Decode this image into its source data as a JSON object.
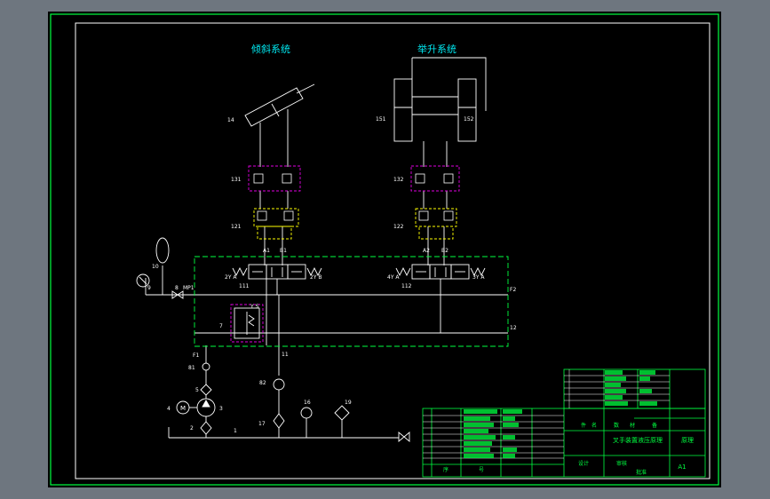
{
  "titles": {
    "tilt": "倾斜系统",
    "lift": "举升系统"
  },
  "labels": {
    "c14": "14",
    "c151": "151",
    "c152": "152",
    "v131": "131",
    "v132": "132",
    "v121": "121",
    "v122": "122",
    "a1": "A1",
    "b1": "B1",
    "a2": "A2",
    "b2": "B2",
    "v111": "111",
    "v112": "112",
    "p2a": "2Y A",
    "p2b": "2Y B",
    "p4a": "4Y A",
    "p4b": "3Y A",
    "f1": "F1",
    "f2": "F2",
    "t11": "11",
    "t12": "12",
    "n10": "10",
    "n9": "9",
    "n8": "8",
    "mp1": "MP1",
    "n7": "7",
    "rv": "Y S",
    "n81": "81",
    "n82": "82",
    "n4": "4",
    "n5": "5",
    "n3": "3",
    "n2": "2",
    "n1": "1",
    "n16": "16",
    "n17": "17",
    "n19": "19",
    "m": "M"
  },
  "titleblock": {
    "drawing_name": "叉手装置液压原理",
    "drawing_name2": "原理",
    "scale": "A1",
    "col_a": "序",
    "col_b": "号",
    "row_labels": [
      "件",
      "名",
      "数",
      "材",
      "备"
    ],
    "signs": [
      "设计",
      "审核",
      "批准"
    ]
  },
  "colors": {
    "frame": "#00ff40",
    "sheet": "#000000",
    "line": "#ffffff",
    "cyan": "#00e8f0",
    "magenta": "#e000e0",
    "yellow": "#ffff00",
    "green": "#00ff40"
  }
}
